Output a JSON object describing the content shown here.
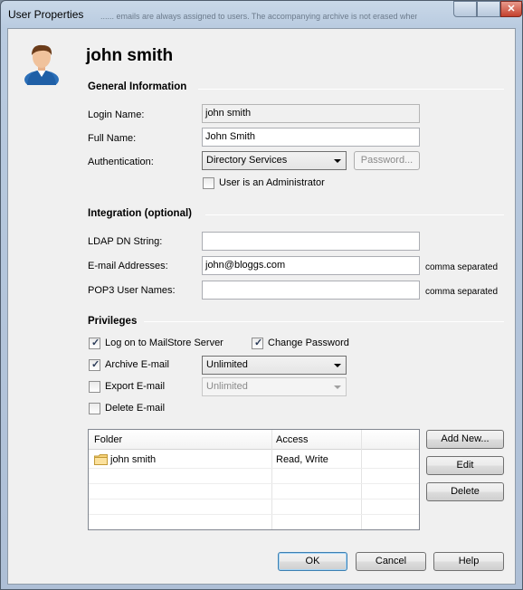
{
  "window": {
    "title": "User Properties",
    "ghost_text": "...... emails are always assigned to users. The accompanying archive is not erased when",
    "close_glyph": "✕"
  },
  "header": {
    "user_name": "john smith"
  },
  "general": {
    "section_title": "General Information",
    "login_label": "Login Name:",
    "login_value": "john smith",
    "fullname_label": "Full Name:",
    "fullname_value": "John Smith",
    "auth_label": "Authentication:",
    "auth_value": "Directory Services",
    "password_button": "Password...",
    "admin_label": "User is an Administrator",
    "admin_checked": false
  },
  "integration": {
    "section_title": "Integration (optional)",
    "ldap_label": "LDAP DN String:",
    "ldap_value": "",
    "email_label": "E-mail Addresses:",
    "email_value": "john@bloggs.com",
    "email_note": "comma separated",
    "pop3_label": "POP3 User Names:",
    "pop3_value": "",
    "pop3_note": "comma separated"
  },
  "privileges": {
    "section_title": "Privileges",
    "logon_label": "Log on to MailStore Server",
    "logon_checked": true,
    "change_pw_label": "Change Password",
    "change_pw_checked": true,
    "archive_label": "Archive E-mail",
    "archive_checked": true,
    "archive_value": "Unlimited",
    "export_label": "Export E-mail",
    "export_checked": false,
    "export_value": "Unlimited",
    "delete_label": "Delete E-mail",
    "delete_checked": false
  },
  "folders": {
    "columns": [
      "Folder",
      "Access"
    ],
    "rows": [
      {
        "folder": "john smith",
        "access": "Read, Write"
      }
    ],
    "add_button": "Add New...",
    "edit_button": "Edit",
    "delete_button": "Delete"
  },
  "footer": {
    "ok_button": "OK",
    "cancel_button": "Cancel",
    "help_button": "Help"
  },
  "colors": {
    "check_mark": "#2a3b58",
    "default_button_border": "#3c7fb1"
  },
  "icons": {
    "avatar": "user-avatar-icon",
    "folder": "folder-icon",
    "checkmark": "✓"
  }
}
